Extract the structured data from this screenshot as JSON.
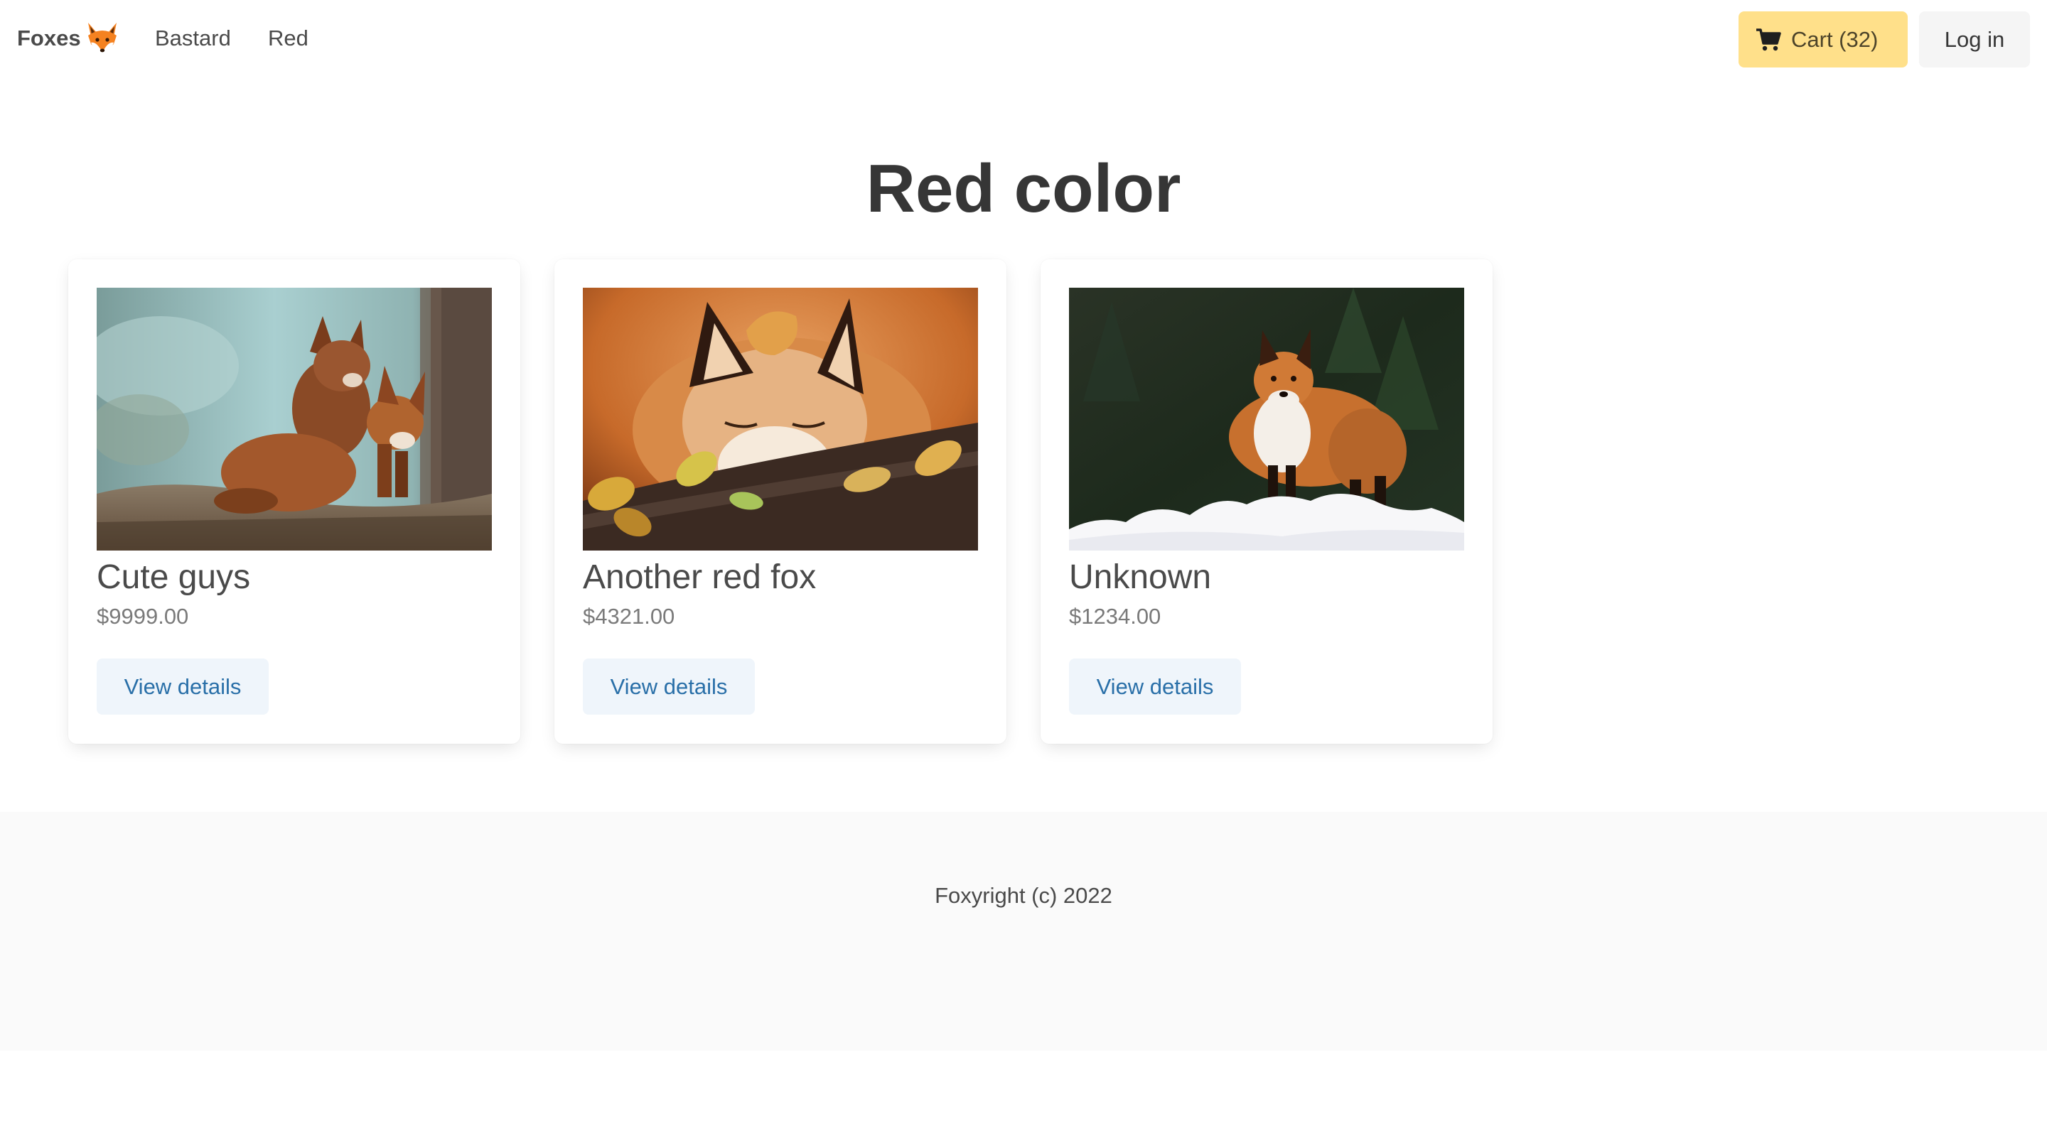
{
  "navbar": {
    "brand": "Foxes",
    "brand_icon": "fox-emoji-icon",
    "links": [
      "Bastard",
      "Red"
    ],
    "cart_label": "Cart (32)",
    "cart_icon": "shopping-cart-icon",
    "login_label": "Log in",
    "cart_color": "#ffe08a"
  },
  "page": {
    "title": "Red color"
  },
  "products": [
    {
      "name": "Cute guys",
      "price": "$9999.00",
      "button": "View details",
      "image": "two-fox-cubs-photo"
    },
    {
      "name": "Another red fox",
      "price": "$4321.00",
      "button": "View details",
      "image": "sleeping-fox-with-leaves-photo"
    },
    {
      "name": "Unknown",
      "price": "$1234.00",
      "button": "View details",
      "image": "fox-in-snow-forest-photo"
    }
  ],
  "footer": {
    "text": "Foxyright (c) 2022"
  },
  "colors": {
    "link_button_bg": "#eff5fb",
    "link_button_text": "#296fa8",
    "footer_bg": "#fafafa"
  }
}
